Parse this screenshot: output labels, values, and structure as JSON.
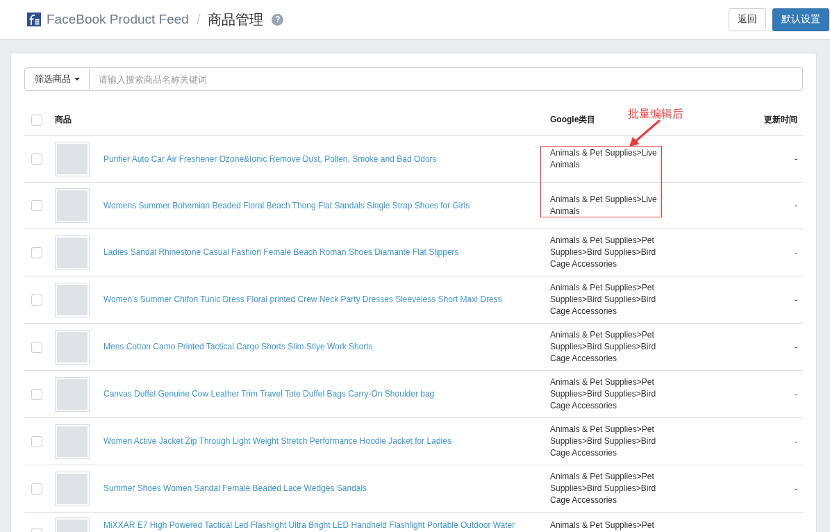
{
  "header": {
    "app_title": "FaceBook Product Feed",
    "separator": "/",
    "page_title": "商品管理",
    "help": "?",
    "buttons": [
      {
        "label": "返回",
        "kind": "default"
      },
      {
        "label": "默认设置",
        "kind": "primary"
      }
    ]
  },
  "filter": {
    "dropdown": "筛选商品",
    "search": {
      "placeholder": "请输入搜索商品名称关键词"
    }
  },
  "table": {
    "all_checked": false,
    "columns": [
      "商品",
      "Google类目",
      "更新时间"
    ],
    "rows": [
      {
        "checked": false,
        "product": "Purifier Auto Car Air Freshener Ozone&Ionic Remove Dust, Pollen, Smoke and Bad Odors",
        "category": "Animals & Pet Supplies>Live Animals",
        "updated": "-"
      },
      {
        "checked": false,
        "product": "Womens Summer Bohemian Beaded Floral Beach Thong Flat Sandals Single Strap Shoes for Girls",
        "category": "Animals & Pet Supplies>Live Animals",
        "updated": "-"
      },
      {
        "checked": false,
        "product": "Ladies Sandal Rhinestone Casual Fashion Female Beach Roman Shoes Diamante Flat Slippers",
        "category": "Animals & Pet Supplies>Pet Supplies>Bird Supplies>Bird Cage Accessories",
        "updated": "-"
      },
      {
        "checked": false,
        "product": "Women's Summer Chifon Tunic Dress Floral printed Crew Neck Party Dresses Sleeveless Short Maxi Dress",
        "category": "Animals & Pet Supplies>Pet Supplies>Bird Supplies>Bird Cage Accessories",
        "updated": "-"
      },
      {
        "checked": false,
        "product": "Mens Cotton Camo Printed Tactical Cargo Shorts Slim Stlye Work Shorts",
        "category": "Animals & Pet Supplies>Pet Supplies>Bird Supplies>Bird Cage Accessories",
        "updated": "-"
      },
      {
        "checked": false,
        "product": "Canvas Duffel Genuine Cow Leather Trim Travel Tote Duffel Bags Carry-On Shoulder bag",
        "category": "Animals & Pet Supplies>Pet Supplies>Bird Supplies>Bird Cage Accessories",
        "updated": "-"
      },
      {
        "checked": false,
        "product": "Women Active Jacket Zip Through Light Weight Stretch Performance Hoodie Jacket for Ladies",
        "category": "Animals & Pet Supplies>Pet Supplies>Bird Supplies>Bird Cage Accessories",
        "updated": "-"
      },
      {
        "checked": false,
        "product": "Summer Shoes Women Sandal Female Beaded Lace Wedges Sandals",
        "category": "Animals & Pet Supplies>Pet Supplies>Bird Supplies>Bird Cage Accessories",
        "updated": "-"
      },
      {
        "checked": false,
        "product": "MiXXAR E7 High Powered Tactical Led Flashlight Ultra Bright LED Handheld Flashlight Portable Outdoor Water",
        "category": "Animals & Pet Supplies>Pet"
      }
    ]
  },
  "annotation": {
    "label": "批量编辑后"
  }
}
